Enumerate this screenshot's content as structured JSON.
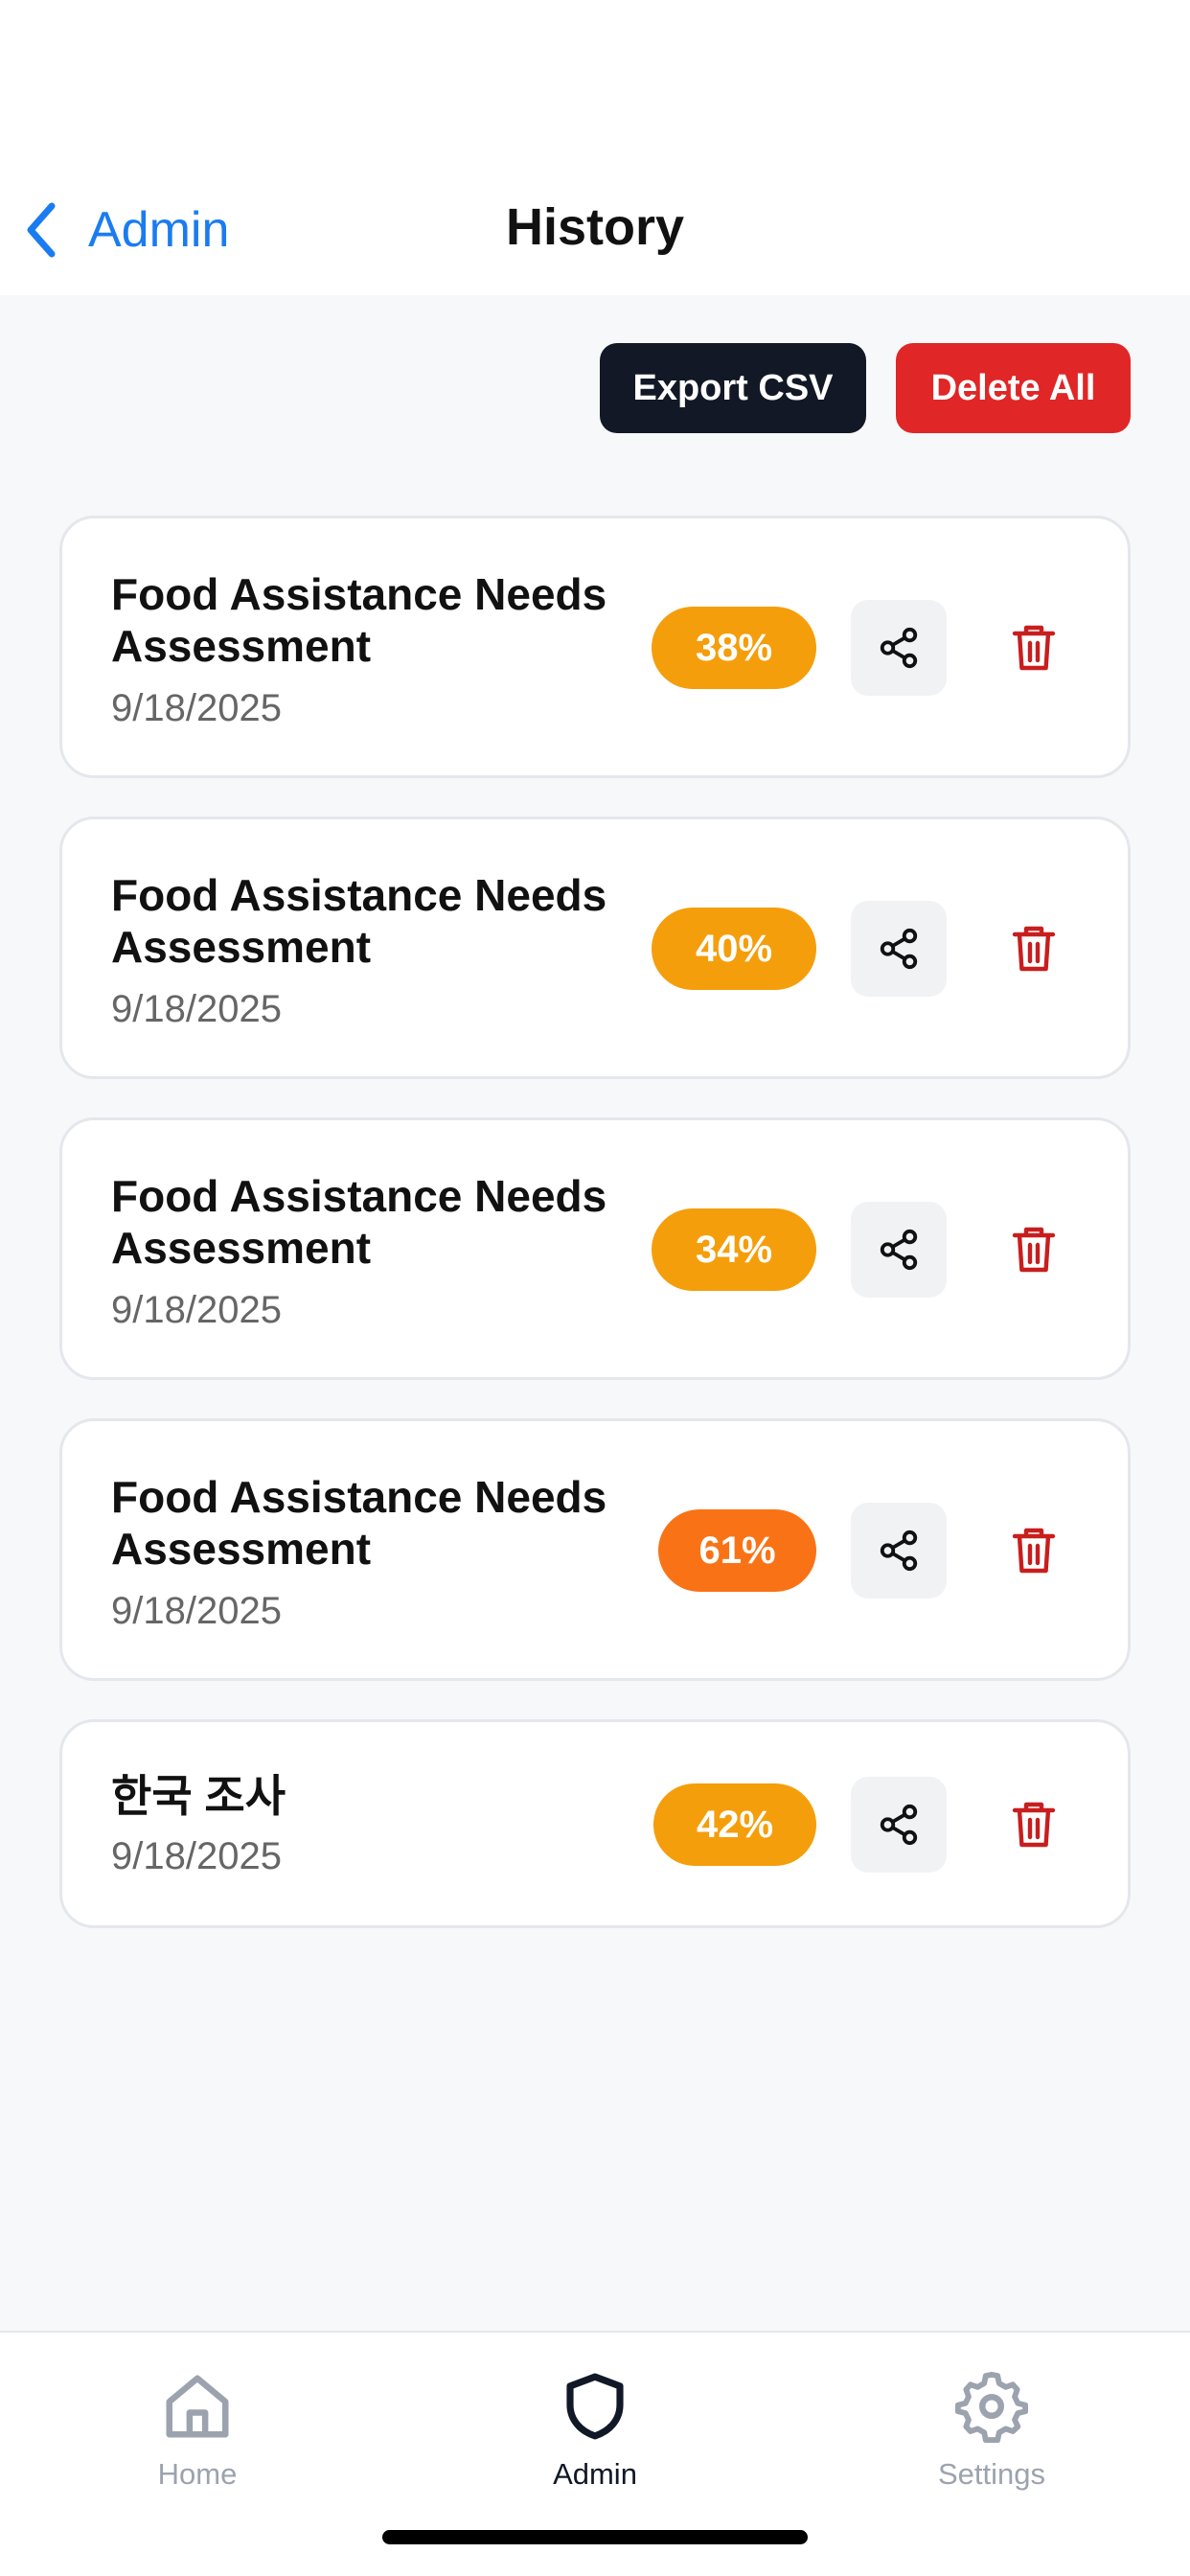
{
  "nav": {
    "back_label": "Admin",
    "title": "History"
  },
  "toolbar": {
    "export_label": "Export CSV",
    "delete_all_label": "Delete All"
  },
  "items": [
    {
      "title": "Food Assistance Needs Assessment",
      "date": "9/18/2025",
      "score": "38%",
      "badge_color": "#f59e0b"
    },
    {
      "title": "Food Assistance Needs Assessment",
      "date": "9/18/2025",
      "score": "40%",
      "badge_color": "#f59e0b"
    },
    {
      "title": "Food Assistance Needs Assessment",
      "date": "9/18/2025",
      "score": "34%",
      "badge_color": "#f59e0b"
    },
    {
      "title": "Food Assistance Needs Assessment",
      "date": "9/18/2025",
      "score": "61%",
      "badge_color": "#f97316"
    },
    {
      "title": "한국 조사",
      "date": "9/18/2025",
      "score": "42%",
      "badge_color": "#f59e0b"
    }
  ],
  "tabs": {
    "home": "Home",
    "admin": "Admin",
    "settings": "Settings"
  },
  "colors": {
    "accent": "#1a7cf0",
    "danger": "#e02626",
    "active_tab": "#111827",
    "inactive_tab": "#9ca3af"
  },
  "icons": {
    "back": "chevron-left-icon",
    "share": "share-icon",
    "trash": "trash-icon",
    "home": "home-icon",
    "admin": "shield-icon",
    "settings": "gear-icon"
  }
}
